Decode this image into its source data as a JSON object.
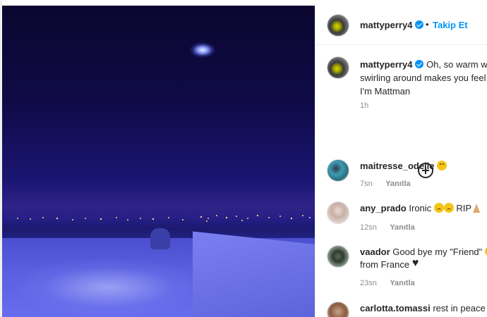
{
  "post": {
    "username": "mattyperry4",
    "follow_label": "Takip Et",
    "separator": "•",
    "caption_lines": [
      "Oh, so warm wa",
      "swirling around makes you feel",
      "I'm Mattman"
    ],
    "caption_time": "1h"
  },
  "comments": [
    {
      "username": "maitresse_odelie",
      "text": "",
      "emojis": [
        "worried"
      ],
      "time": "7sn",
      "reply": "Yanıtla"
    },
    {
      "username": "any_prado",
      "text": "Ironic",
      "emojis": [
        "sad",
        "sad"
      ],
      "text2": "RIP",
      "emojis2": [
        "pray"
      ],
      "time": "12sn",
      "reply": "Yanıtla"
    },
    {
      "username": "vaador",
      "text": "Good bye my \"Friend\"",
      "line2": "from France",
      "emojis": [
        "cry"
      ],
      "emojis2": [
        "heart"
      ],
      "time": "23sn",
      "reply": "Yanıtla"
    },
    {
      "username": "carlotta.tomassi",
      "text": "rest in peace v"
    }
  ],
  "icons": {
    "verified": "verified-badge-icon",
    "new_comments": "plus-circle-icon"
  },
  "colors": {
    "link_blue": "#0095f6",
    "meta_gray": "#8e8e8e"
  }
}
